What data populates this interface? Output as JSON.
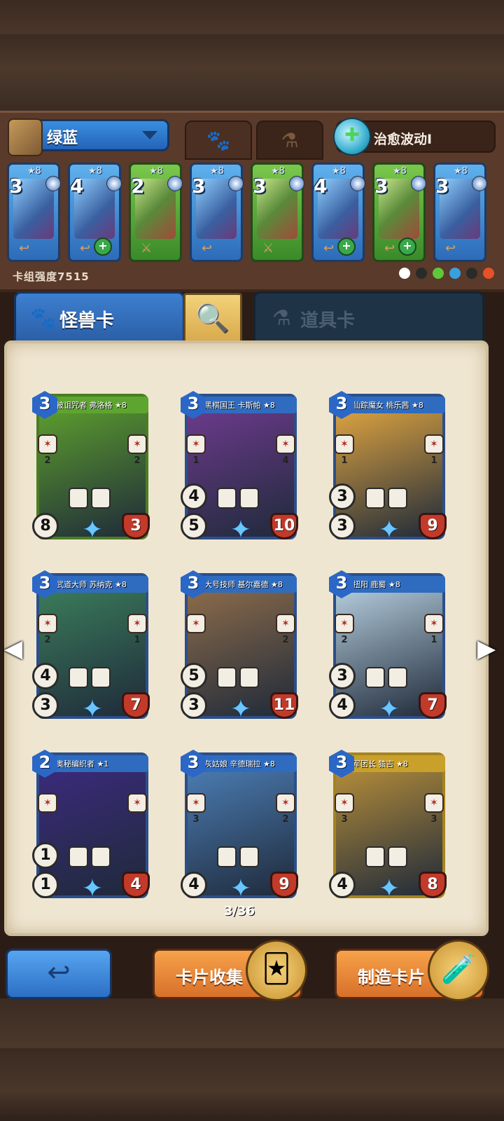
{
  "deck": {
    "name": "绿蓝",
    "tab_monster_icon": "paw-icon",
    "tab_item_icon": "flask-icon",
    "spell_name": "治愈波动I",
    "strength_text": "卡组强度7515",
    "cards": [
      {
        "cost": "3",
        "stars": "★8",
        "frame": "blue"
      },
      {
        "cost": "4",
        "stars": "★8",
        "frame": "blue"
      },
      {
        "cost": "2",
        "stars": "★8",
        "frame": "green"
      },
      {
        "cost": "3",
        "stars": "★8",
        "frame": "blue"
      },
      {
        "cost": "3",
        "stars": "★8",
        "frame": "green"
      },
      {
        "cost": "4",
        "stars": "★8",
        "frame": "blue"
      },
      {
        "cost": "3",
        "stars": "★8",
        "frame": "green"
      },
      {
        "cost": "3",
        "stars": "★8",
        "frame": "blue"
      }
    ],
    "element_colors": [
      "#ffffff",
      "#2a2a2a",
      "#5fc73a",
      "#39a0e0",
      "#2a2a2a",
      "#e8502a"
    ]
  },
  "tabs": {
    "monster_label": "怪兽卡",
    "item_label": "道具卡"
  },
  "cards": [
    {
      "name": "被诅咒者 弗洛格 ★8",
      "cost": "3",
      "frame": "green",
      "skill_l": "2",
      "skill_r": "2",
      "stat_top": "",
      "stat_bottom": "8",
      "hp": "3",
      "art": "#5a9a2e"
    },
    {
      "name": "黑棋国王 卡斯帕 ★8",
      "cost": "3",
      "frame": "blue",
      "skill_l": "1",
      "skill_r": "4",
      "stat_top": "4",
      "stat_bottom": "5",
      "hp": "10",
      "art": "#6a3a8a"
    },
    {
      "name": "仙踪魔女 桃乐茜 ★8",
      "cost": "3",
      "frame": "blue",
      "skill_l": "1",
      "skill_r": "1",
      "stat_top": "3",
      "stat_bottom": "3",
      "hp": "9",
      "art": "#d8a040"
    },
    {
      "name": "武道大师 苏纳克 ★8",
      "cost": "3",
      "frame": "blue",
      "skill_l": "2",
      "skill_r": "1",
      "stat_top": "4",
      "stat_bottom": "3",
      "hp": "7",
      "art": "#3a7a5a"
    },
    {
      "name": "大号技师 基尔嘉德 ★8",
      "cost": "3",
      "frame": "blue",
      "skill_l": "",
      "skill_r": "2",
      "stat_top": "5",
      "stat_bottom": "3",
      "hp": "11",
      "art": "#8a6a4a"
    },
    {
      "name": "扭阳 鹿蜀 ★8",
      "cost": "3",
      "frame": "blue",
      "skill_l": "2",
      "skill_r": "1",
      "stat_top": "3",
      "stat_bottom": "4",
      "hp": "7",
      "art": "#b0c8d8"
    },
    {
      "name": "奥秘编织者 ★1",
      "cost": "2",
      "frame": "blue",
      "skill_l": "",
      "skill_r": "",
      "stat_top": "1",
      "stat_bottom": "1",
      "hp": "4",
      "art": "#3a2a7a"
    },
    {
      "name": "灰姑娘 辛德瑞拉 ★8",
      "cost": "3",
      "frame": "blue",
      "skill_l": "3",
      "skill_r": "2",
      "stat_top": "",
      "stat_bottom": "4",
      "hp": "9",
      "art": "#4a7ab0"
    },
    {
      "name": "军团长 猿吉 ★8",
      "cost": "3",
      "frame": "gold",
      "skill_l": "3",
      "skill_r": "3",
      "stat_top": "",
      "stat_bottom": "4",
      "hp": "8",
      "art": "#b08a3a"
    }
  ],
  "pagination": {
    "text": "3/36"
  },
  "buttons": {
    "back_icon": "back-arrow-icon",
    "collect_label": "卡片收集",
    "craft_label": "制造卡片"
  }
}
